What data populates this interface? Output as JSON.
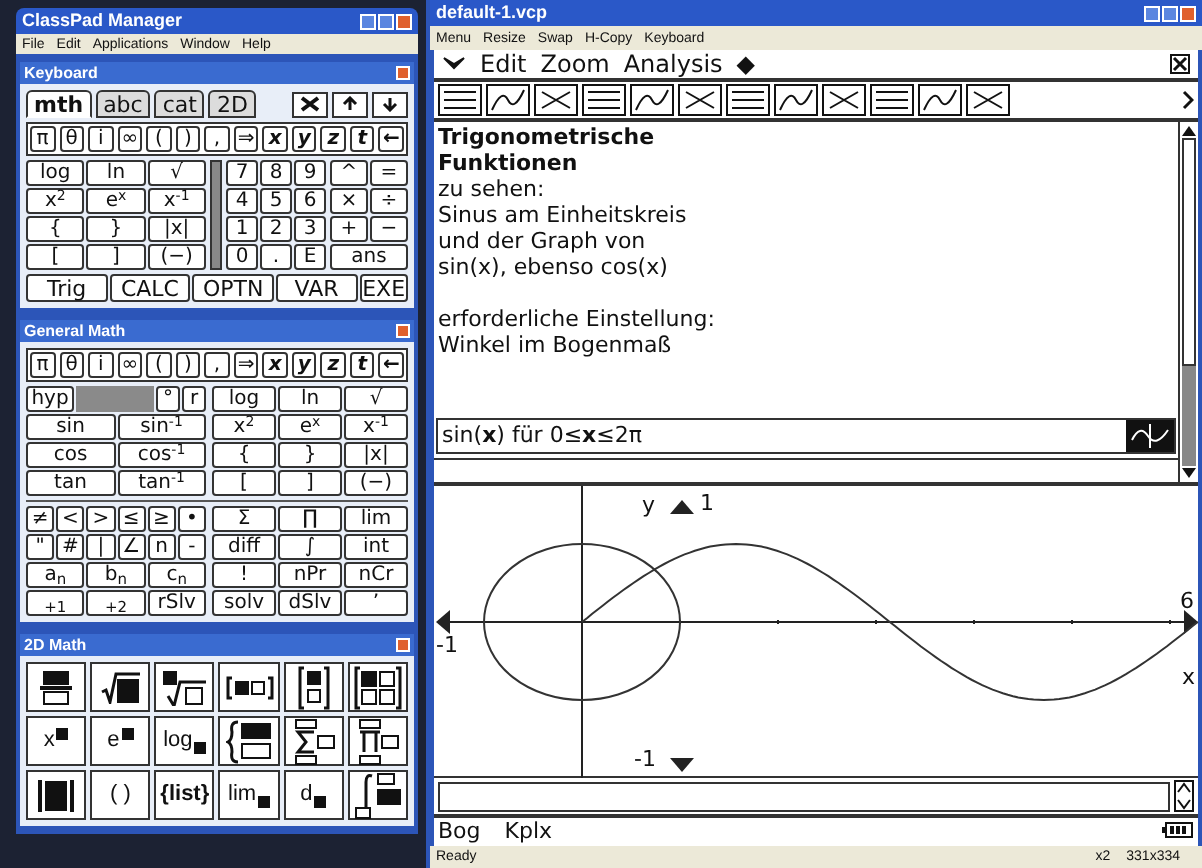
{
  "manager": {
    "title": "ClassPad Manager",
    "menu": [
      "File",
      "Edit",
      "Applications",
      "Window",
      "Help"
    ]
  },
  "keyboard": {
    "title": "Keyboard",
    "tabs": [
      {
        "label": "mth",
        "selected": true
      },
      {
        "label": "abc",
        "selected": false
      },
      {
        "label": "cat",
        "selected": false
      },
      {
        "label": "2D",
        "selected": false
      }
    ],
    "symbols": [
      "π",
      "θ",
      "i",
      "∞",
      "(",
      ")",
      ",",
      "⇒",
      "x",
      "y",
      "z",
      "t",
      "←"
    ],
    "functions": [
      "log",
      "ln",
      "√",
      "x$^{2}$",
      "e$^{x}$",
      "x$^{-1}$",
      "{",
      "}",
      "|x|",
      "[",
      "]",
      "(−)"
    ],
    "numpad": [
      "7",
      "8",
      "9",
      "4",
      "5",
      "6",
      "1",
      "2",
      "3",
      "0",
      ".",
      "E"
    ],
    "operators": [
      "^",
      "=",
      "×",
      "÷",
      "+",
      "−",
      "ans"
    ],
    "softkeys": [
      "Trig",
      "CALC",
      "OPTN",
      "VAR",
      "EXE"
    ]
  },
  "general_math": {
    "title": "General Math",
    "symbols": [
      "π",
      "θ",
      "i",
      "∞",
      "(",
      ")",
      ",",
      "⇒",
      "x",
      "y",
      "z",
      "t",
      "←"
    ],
    "hyp": "hyp",
    "angle_keys": [
      "°",
      "r"
    ],
    "trig": [
      "sin",
      "sin$^{-1}$",
      "cos",
      "cos$^{-1}$",
      "tan",
      "tan$^{-1}$"
    ],
    "functions": [
      "log",
      "ln",
      "√",
      "x$^{2}$",
      "e$^{x}$",
      "x$^{-1}$",
      "{",
      "}",
      "|x|",
      "[",
      "]",
      "(−)"
    ],
    "relations": [
      "≠",
      "<",
      ">",
      "≤",
      "≥",
      "•",
      "\"",
      "#",
      "|",
      "∠",
      "n",
      "-"
    ],
    "sequence": [
      "a$_{n}$",
      "b$_{n}$",
      "c$_{n}$",
      "$_{+1}$",
      "$_{+2}$",
      "rSlv"
    ],
    "advanced": [
      "Σ",
      "∏",
      "lim",
      "diff",
      "∫",
      "int",
      "!",
      "nPr",
      "nCr",
      "solv",
      "dSlv",
      "’"
    ]
  },
  "math_2d": {
    "title": "2D Math",
    "templates": [
      {
        "kind": "fraction"
      },
      {
        "kind": "sqrt"
      },
      {
        "kind": "root"
      },
      {
        "kind": "vector"
      },
      {
        "kind": "column"
      },
      {
        "kind": "matrix"
      },
      {
        "kind": "power",
        "label": "x"
      },
      {
        "kind": "power",
        "label": "e"
      },
      {
        "kind": "log",
        "label": "log"
      },
      {
        "kind": "piecewise"
      },
      {
        "kind": "sum"
      },
      {
        "kind": "product"
      },
      {
        "kind": "abs"
      },
      {
        "kind": "parens",
        "label": "( )"
      },
      {
        "kind": "list",
        "label": "{list}"
      },
      {
        "kind": "limit",
        "label": "lim"
      },
      {
        "kind": "derivative",
        "label": "d"
      },
      {
        "kind": "integral"
      }
    ]
  },
  "document": {
    "title": "default-1.vcp",
    "menu": [
      "Menu",
      "Resize",
      "Swap",
      "H-Copy",
      "Keyboard"
    ],
    "app_menu": [
      "Edit",
      "Zoom",
      "Analysis",
      "◆"
    ],
    "lines": [
      {
        "text": "Trigonometrische",
        "bold": true
      },
      {
        "text": "Funktionen",
        "bold": true
      },
      {
        "text": "zu sehen:",
        "bold": false
      },
      {
        "text": "Sinus am Einheitskreis",
        "bold": false
      },
      {
        "text": "und der Graph von",
        "bold": false
      },
      {
        "text": "sin(x), ebenso cos(x)",
        "bold": false
      },
      {
        "kind": "blank"
      },
      {
        "text": "erforderliche Einstellung:",
        "bold": false
      },
      {
        "text": "Winkel im Bogenmaß",
        "bold": false
      }
    ],
    "expression": "sin(**x**) für 0≤**x**≤2π",
    "graph": {
      "y_label": "y",
      "y_max": "1",
      "y_min": "-1",
      "x_min": "-1",
      "x_max": "6",
      "x_label": "x"
    },
    "status_left": [
      "Bog",
      "Kplx"
    ]
  },
  "status_bar": {
    "text": "Ready",
    "zoom": "x2",
    "size": "331x334"
  }
}
